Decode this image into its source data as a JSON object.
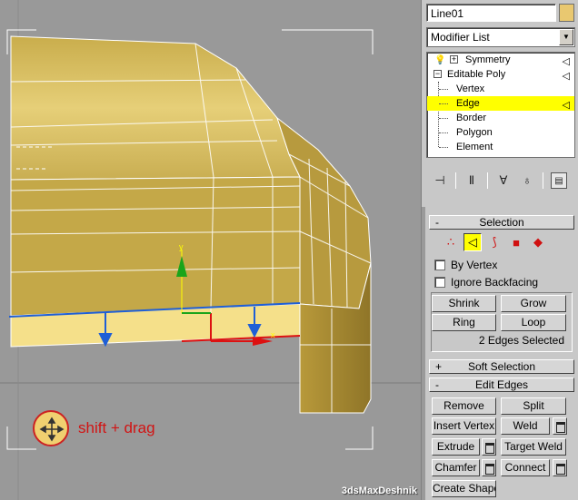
{
  "object_name": "Line01",
  "object_color": "#e9c870",
  "modifier_list": {
    "selected": "Modifier List"
  },
  "stack": [
    {
      "label": "Symmetry",
      "level": 0,
      "selected": false
    },
    {
      "label": "Editable Poly",
      "level": 0,
      "selected": false
    },
    {
      "label": "Vertex",
      "level": 1,
      "selected": false
    },
    {
      "label": "Edge",
      "level": 1,
      "selected": true
    },
    {
      "label": "Border",
      "level": 1,
      "selected": false
    },
    {
      "label": "Polygon",
      "level": 1,
      "selected": false
    },
    {
      "label": "Element",
      "level": 1,
      "selected": false
    }
  ],
  "toolbar_icons": [
    "pin-stack-icon",
    "show-end-result-icon",
    "make-unique-icon",
    "remove-modifier-icon",
    "configure-modifier-sets-icon"
  ],
  "selection": {
    "title": "Selection",
    "sign": "-",
    "modes": [
      "vertex-mode-icon",
      "edge-mode-icon",
      "border-mode-icon",
      "polygon-mode-icon",
      "element-mode-icon"
    ],
    "active_mode": "edge-mode-icon",
    "by_vertex": "By Vertex",
    "ignore_backfacing": "Ignore Backfacing",
    "shrink": "Shrink",
    "grow": "Grow",
    "ring": "Ring",
    "loop": "Loop",
    "status": "2 Edges Selected"
  },
  "soft_selection": {
    "title": "Soft Selection",
    "sign": "+"
  },
  "edit_edges": {
    "title": "Edit Edges",
    "sign": "-",
    "remove": "Remove",
    "split": "Split",
    "insert_vertex": "Insert Vertex",
    "weld": "Weld",
    "extrude": "Extrude",
    "target_weld": "Target Weld",
    "chamfer": "Chamfer",
    "connect": "Connect",
    "create_shape": "Create Shape"
  },
  "viewport": {
    "hint": "shift + drag",
    "watermark": "3dsMaxDeshnik",
    "gizmo_y": "y",
    "gizmo_x": "x"
  },
  "colors": {
    "model_face": "#c8b04a",
    "model_highlight": "#f5e08a",
    "selected_edge": "#1f5fd6",
    "gizmo_y": "#1aa51a",
    "gizmo_x": "#dd1111",
    "hint": "#d11414",
    "stack_selection": "#ffff00"
  }
}
